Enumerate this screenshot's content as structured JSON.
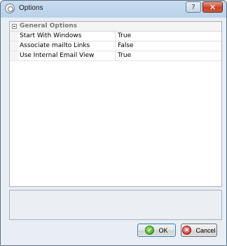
{
  "window": {
    "title": "Options",
    "help_glyph": "?",
    "close_glyph": "✕"
  },
  "grid": {
    "category": {
      "label": "General Options",
      "expanded": true
    },
    "properties": [
      {
        "name": "Start With Windows",
        "value": "True"
      },
      {
        "name": "Associate mailto Links",
        "value": "False"
      },
      {
        "name": "Use Internal Email View",
        "value": "True"
      }
    ]
  },
  "buttons": {
    "ok_label": "OK",
    "ok_glyph": "✓",
    "cancel_label": "Cancel",
    "cancel_glyph": "✕"
  },
  "colors": {
    "ok_icon": "#3a9a1f",
    "cancel_icon": "#c41f1f"
  }
}
